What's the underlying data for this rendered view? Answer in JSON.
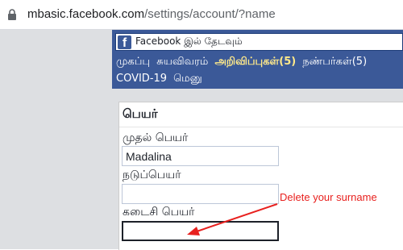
{
  "browser": {
    "url_host": "mbasic.facebook.com",
    "url_path": "/settings/account/?name"
  },
  "header": {
    "logo_letter": "f",
    "search_placeholder": "Facebook இல் தேடவும்",
    "nav": {
      "home": "முகப்பு",
      "profile": "சுயவிவரம்",
      "notifications": "அறிவிப்புகள்(5)",
      "friends": "நண்பர்கள்(5)",
      "covid": "COVID-19",
      "menu": "மெனு"
    }
  },
  "form": {
    "section_title": "பெயர்",
    "first_name_label": "முதல் பெயர்",
    "first_name_value": "Madalina",
    "middle_name_label": "நடுப்பெயர்",
    "middle_name_value": "",
    "last_name_label": "கடைசி பெயர்",
    "last_name_value": ""
  },
  "annotation": {
    "text": "Delete your surname",
    "color": "#e8201e"
  },
  "colors": {
    "facebook_blue": "#3b5998",
    "page_gray": "#dddfe2",
    "notification_yellow": "#ffe98a"
  }
}
